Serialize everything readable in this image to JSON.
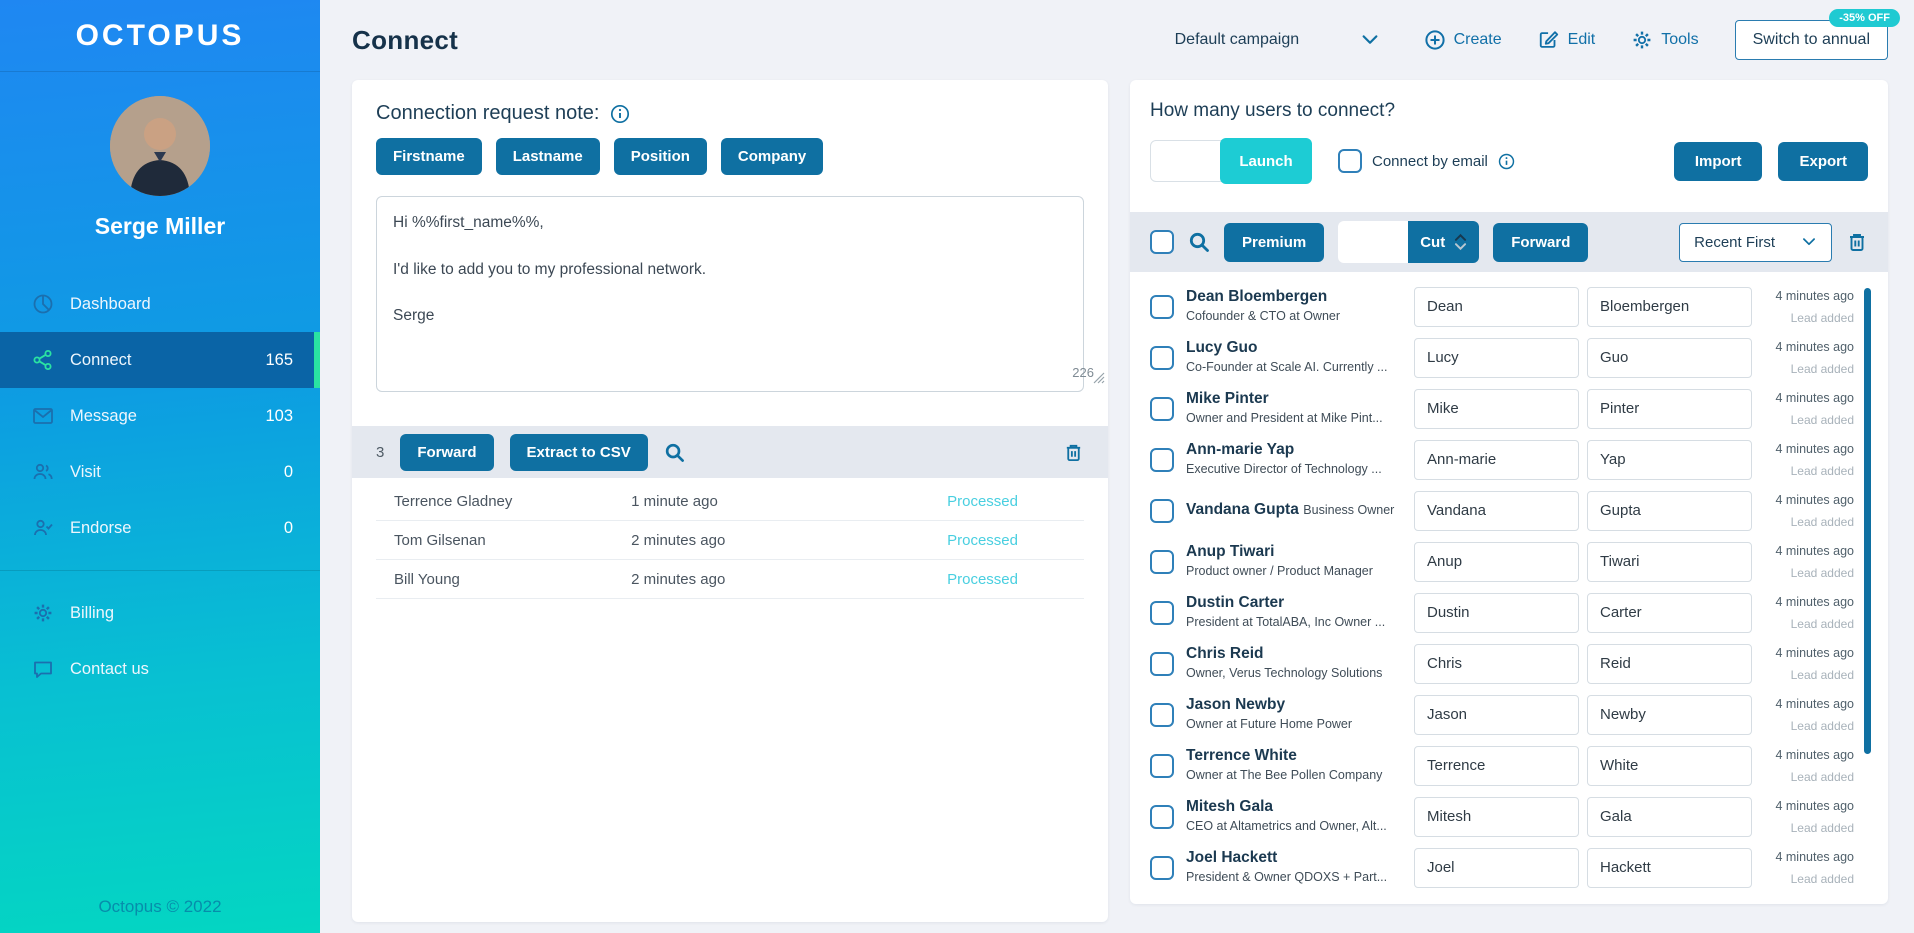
{
  "brand": {
    "logo": "OCTOPUS",
    "footer": "Octopus © 2022"
  },
  "user": {
    "name": "Serge Miller"
  },
  "sidebar": {
    "items": [
      {
        "label": "Dashboard",
        "count": ""
      },
      {
        "label": "Connect",
        "count": "165"
      },
      {
        "label": "Message",
        "count": "103"
      },
      {
        "label": "Visit",
        "count": "0"
      },
      {
        "label": "Endorse",
        "count": "0"
      }
    ],
    "secondary": [
      {
        "label": "Billing"
      },
      {
        "label": "Contact us"
      }
    ]
  },
  "header": {
    "title": "Connect",
    "campaign_selected": "Default campaign",
    "create_label": "Create",
    "edit_label": "Edit",
    "tools_label": "Tools",
    "switch_annual_label": "Switch to annual",
    "discount_badge": "-35% OFF"
  },
  "note_panel": {
    "title": "Connection request note:",
    "tags": [
      "Firstname",
      "Lastname",
      "Position",
      "Company"
    ],
    "message": "Hi %%first_name%%,\n\nI'd like to add you to my professional network.\n\nSerge",
    "char_count": "226",
    "toolbar": {
      "count": "3",
      "forward_label": "Forward",
      "extract_label": "Extract to CSV"
    },
    "processed": [
      {
        "name": "Terrence Gladney",
        "time": "1 minute ago",
        "status": "Processed"
      },
      {
        "name": "Tom Gilsenan",
        "time": "2 minutes ago",
        "status": "Processed"
      },
      {
        "name": "Bill Young",
        "time": "2 minutes ago",
        "status": "Processed"
      }
    ]
  },
  "connect_panel": {
    "title": "How many users to connect?",
    "launch_label": "Launch",
    "connect_by_email_label": "Connect by email",
    "import_label": "Import",
    "export_label": "Export",
    "toolbar": {
      "premium_label": "Premium",
      "cut_label": "Cut",
      "forward_label": "Forward",
      "sort_selected": "Recent First"
    },
    "lead_time": "4 minutes ago",
    "lead_note": "Lead added",
    "users": [
      {
        "name": "Dean Bloembergen",
        "title": "Cofounder & CTO at Owner",
        "first": "Dean",
        "last": "Bloembergen"
      },
      {
        "name": "Lucy Guo",
        "title": "Co-Founder at Scale AI. Currently ...",
        "first": "Lucy",
        "last": "Guo"
      },
      {
        "name": "Mike Pinter",
        "title": "Owner and President at Mike Pint...",
        "first": "Mike",
        "last": "Pinter"
      },
      {
        "name": "Ann-marie Yap",
        "title": "Executive Director of Technology ...",
        "first": "Ann-marie",
        "last": "Yap"
      },
      {
        "name": "Vandana Gupta",
        "title": "Business Owner",
        "first": "Vandana",
        "last": "Gupta"
      },
      {
        "name": "Anup Tiwari",
        "title": "Product owner / Product Manager",
        "first": "Anup",
        "last": "Tiwari"
      },
      {
        "name": "Dustin Carter",
        "title": "President at TotalABA, Inc Owner ...",
        "first": "Dustin",
        "last": "Carter"
      },
      {
        "name": "Chris Reid",
        "title": "Owner, Verus Technology Solutions",
        "first": "Chris",
        "last": "Reid"
      },
      {
        "name": "Jason Newby",
        "title": "Owner at Future Home Power",
        "first": "Jason",
        "last": "Newby"
      },
      {
        "name": "Terrence White",
        "title": "Owner at The Bee Pollen Company",
        "first": "Terrence",
        "last": "White"
      },
      {
        "name": "Mitesh Gala",
        "title": "CEO at Altametrics and Owner, Alt...",
        "first": "Mitesh",
        "last": "Gala"
      },
      {
        "name": "Joel Hackett",
        "title": "President & Owner QDOXS + Part...",
        "first": "Joel",
        "last": "Hackett"
      }
    ]
  },
  "colors": {
    "primary_blue": "#0f70a2",
    "teal": "#1dccd4",
    "accent_green": "#2ae3a2",
    "sidebar_top": "#1f87f2",
    "sidebar_bottom": "#04d6c2",
    "status_cyan": "#49cfe0"
  }
}
